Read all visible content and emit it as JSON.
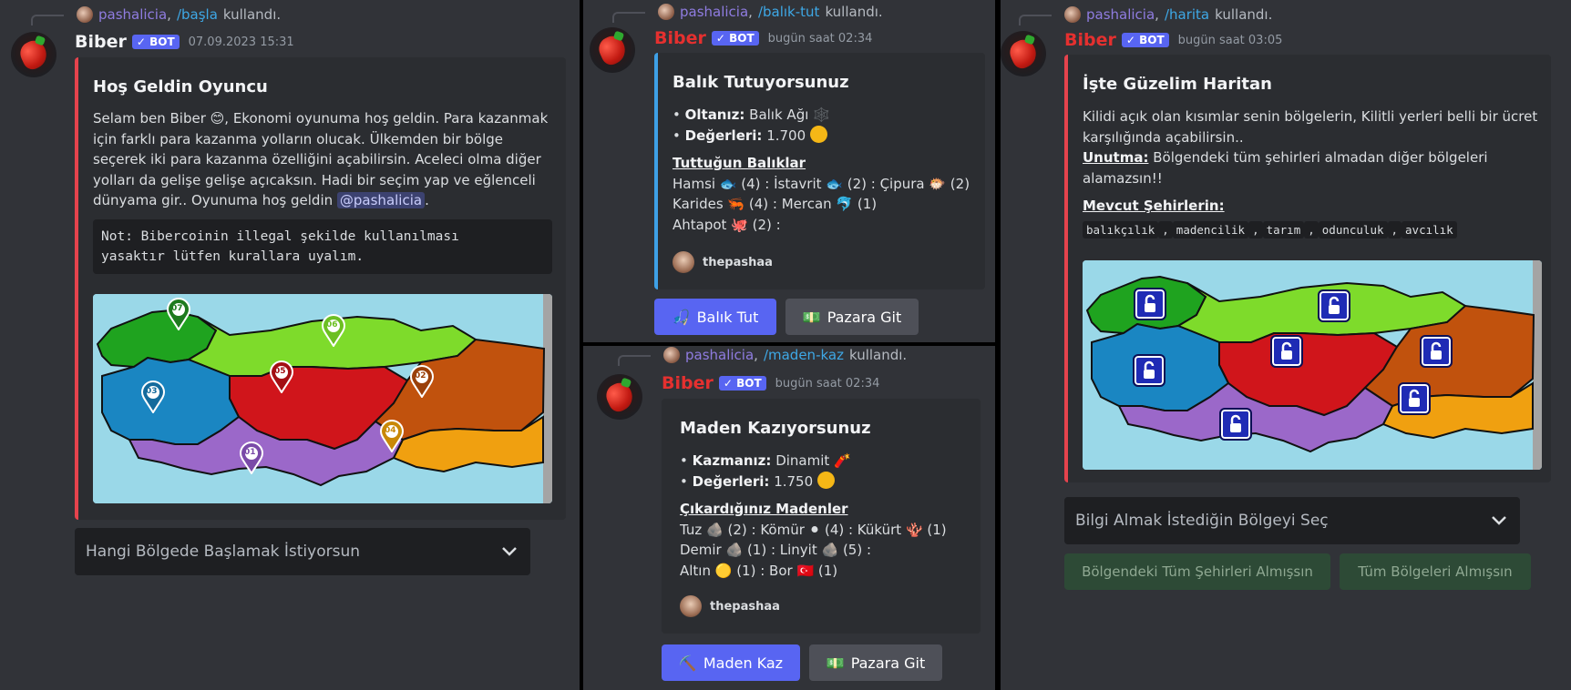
{
  "panels": [
    {
      "reply": {
        "user": "pashalicia",
        "sep": ",",
        "command": "/başla",
        "suffix": "kullandı."
      },
      "bot": {
        "name": "Biber",
        "tag": "✓ BOT",
        "timestamp": "07.09.2023 15:31",
        "name_color": "#f2f3f5"
      },
      "embed": {
        "color": "#e5434d",
        "title": "Hoş Geldin Oyuncu",
        "lines": [
          "Selam ben Biber 😊, Ekonomi oyunuma hoş geldin. Para kazanmak",
          "için farklı para kazanma yolların olucak. Ülkemden bir bölge",
          "seçerek iki para kazanma özelliğini açabilirsin. Aceleci olma diğer",
          "yolları da gelişe gelişe açıcaksın. Hadi bir seçim yap ve eğlenceli",
          "dünyama gir.. Oyunuma hoş geldin"
        ],
        "mention": "@pashalicia",
        "mention_tail": ".",
        "code": [
          "Not: Bibercoinin illegal şekilde kullanılması",
          "yasaktır lütfen kurallara uyalım."
        ],
        "map_pins": [
          "07",
          "06",
          "05",
          "03",
          "02",
          "04",
          "01"
        ]
      },
      "select": {
        "placeholder": "Hangi Bölgede Başlamak İstiyorsun"
      }
    },
    {
      "reply": {
        "user": "pashalicia",
        "sep": ",",
        "command": "/balık-tut",
        "suffix": "kullandı."
      },
      "bot": {
        "name": "Biber",
        "tag": "✓ BOT",
        "timestamp": "bugün saat 02:34",
        "name_color": "#e5302f"
      },
      "embed": {
        "color": "#3ea0e6",
        "title": "Balık Tutuyorsunuz",
        "field1_label": "Oltanız:",
        "field1_value": "Balık Ağı 🕸️",
        "field2_label": "Değerleri:",
        "field2_value": "1.700",
        "subtitle": "Tuttuğun Balıklar",
        "rows": [
          "Hamsi 🐟 (4) : İstavrit 🐟 (2) : Çipura 🐡 (2)",
          "Karides 🦐 (4) : Mercan 🐬 (1)",
          "Ahtapot 🐙 (2) :"
        ],
        "footer": "thepashaa"
      },
      "buttons": [
        {
          "label": "Balık Tut",
          "icon": "🎣"
        },
        {
          "label": "Pazara Git",
          "icon": "💵"
        }
      ]
    },
    {
      "reply": {
        "user": "pashalicia",
        "sep": ",",
        "command": "/maden-kaz",
        "suffix": "kullandı."
      },
      "bot": {
        "name": "Biber",
        "tag": "✓ BOT",
        "timestamp": "bugün saat 02:34",
        "name_color": "#e5302f"
      },
      "embed": {
        "color": "#2b2d31",
        "title": "Maden Kazıyorsunuz",
        "field1_label": "Kazmanız:",
        "field1_value": "Dinamit 🧨",
        "field2_label": "Değerleri:",
        "field2_value": "1.750",
        "subtitle": "Çıkardığınız Madenler",
        "rows": [
          "Tuz 🪨 (2) : Kömür ⚫ (4) : Kükürt 🪸 (1)",
          "Demir 🪨 (1) : Linyit 🪨 (5) :",
          "Altın 🟡 (1) : Bor 🇹🇷 (1)"
        ],
        "footer": "thepashaa"
      },
      "buttons": [
        {
          "label": "Maden Kaz",
          "icon": "⛏️"
        },
        {
          "label": "Pazara Git",
          "icon": "💵"
        }
      ]
    },
    {
      "reply": {
        "user": "pashalicia",
        "sep": ",",
        "command": "/harita",
        "suffix": "kullandı."
      },
      "bot": {
        "name": "Biber",
        "tag": "✓ BOT",
        "timestamp": "bugün saat 03:05",
        "name_color": "#e5302f"
      },
      "embed": {
        "color": "#e5434d",
        "title": "İşte Güzelim Haritan",
        "lines": [
          "Kilidi açık olan kısımlar senin bölgelerin, Kilitli yerleri belli bir ücret",
          "karşılığında açabilirsin.."
        ],
        "unutma_label": "Unutma:",
        "unutma_text": "Bölgendeki tüm şehirleri almadan diğer bölgeleri",
        "unutma_text2": "alamazsın!!",
        "cities_label": "Mevcut Şehirlerin:",
        "cities": [
          "balıkçılık",
          "madencilik",
          "tarım",
          "odunculuk",
          "avcılık"
        ],
        "cities_sep": ","
      },
      "select": {
        "placeholder": "Bilgi Almak İstediğin Bölgeyi Seç"
      },
      "buttons": [
        {
          "label": "Bölgendeki Tüm Şehirleri Almışsın"
        },
        {
          "label": "Tüm Bölgeleri Almışsın"
        }
      ]
    }
  ]
}
